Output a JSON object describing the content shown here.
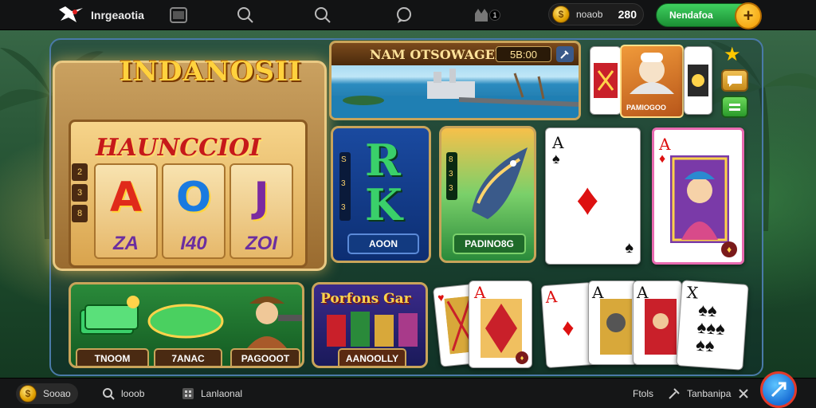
{
  "topbar": {
    "brand": "Inrgeaotia",
    "coins_label": "noaob",
    "coins_value": "280",
    "deposit_label": "Nendafoa",
    "deposit_plus": "+",
    "notif_count": "1"
  },
  "featured_slot": {
    "title": "INDANOSII",
    "subtitle": "HAUNCCIOI",
    "symbols": [
      "A",
      "O",
      "J"
    ],
    "values": [
      "ZA",
      "I40",
      "ZOI"
    ],
    "side_numbers": [
      "2",
      "3",
      "8"
    ]
  },
  "port_banner": {
    "title": "NAM OTSOWAGEM",
    "value": "5B:00"
  },
  "tiles": {
    "rk_game": {
      "letters": [
        "R",
        "K"
      ],
      "side": [
        "S",
        "3",
        "3"
      ],
      "button": "AOON"
    },
    "fish_game": {
      "side": [
        "8",
        "3",
        "3"
      ],
      "button": "PADINO8G"
    },
    "poker_badge": "PAMIOGOO",
    "cash_game": {
      "button": "TNOOM",
      "button2": "7ANAC"
    },
    "explorer_game": {
      "button": "PAGOOOT"
    },
    "fortune_game": {
      "title": "Porfons Gar",
      "button": "AANOOLLY"
    }
  },
  "cards": {
    "ace_spade": "A",
    "ace_diamond": "A",
    "ace_small": "A",
    "x_card": "X"
  },
  "bottombar": {
    "coin_label": "Sooao",
    "search_label": "looob",
    "lobby_label": "Lanlaonal",
    "right_label1": "Ftols",
    "right_label2": "Tanbanipa"
  },
  "colors": {
    "accent_green": "#2bb24c",
    "accent_gold": "#ffc800",
    "panel_border": "#4a7aa8",
    "topbar_bg": "#121314"
  },
  "icons": [
    "bird-logo-icon",
    "window-icon",
    "search-icon",
    "search-icon",
    "chat-icon",
    "shop-icon",
    "coin-icon",
    "plus-icon",
    "star-icon",
    "chat-bubble-icon",
    "chip-icon",
    "close-icon",
    "tools-icon",
    "fab-icon"
  ]
}
